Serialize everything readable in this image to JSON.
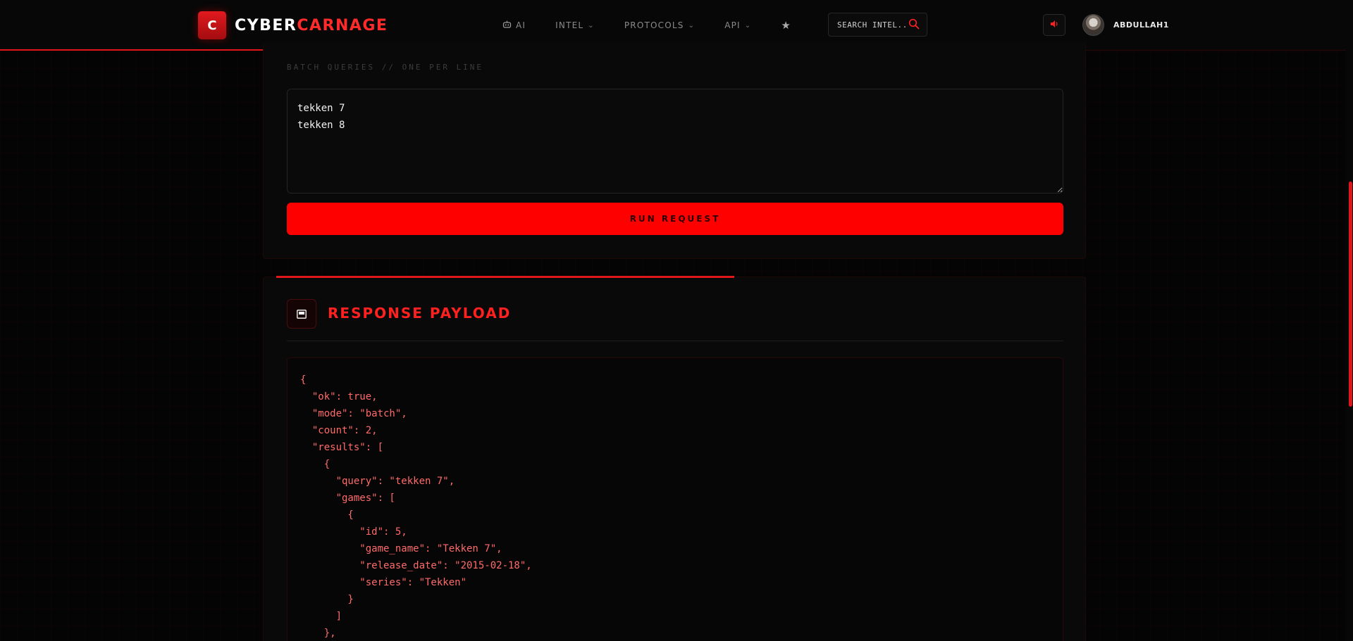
{
  "brand": {
    "logo_letter": "C",
    "name_part1": "CYBER",
    "name_part2": "CARNAGE"
  },
  "nav": {
    "items": [
      {
        "label": "AI",
        "icon": "robot-icon",
        "has_dropdown": false
      },
      {
        "label": "INTEL",
        "has_dropdown": true
      },
      {
        "label": "PROTOCOLS",
        "has_dropdown": true
      },
      {
        "label": "API",
        "has_dropdown": true
      }
    ],
    "favorites_icon": "star-icon"
  },
  "search": {
    "placeholder": "SEARCH INTEL..."
  },
  "user": {
    "name": "ABDULLAH1",
    "audio_icon": "speaker-icon"
  },
  "request": {
    "field_label": "BATCH QUERIES // ONE PER LINE",
    "textarea_value": "tekken 7\ntekken 8",
    "run_button": "RUN REQUEST"
  },
  "response": {
    "title": "RESPONSE PAYLOAD",
    "icon": "terminal-icon",
    "payload_visible": "{\n  \"ok\": true,\n  \"mode\": \"batch\",\n  \"count\": 2,\n  \"results\": [\n    {\n      \"query\": \"tekken 7\",\n      \"games\": [\n        {\n          \"id\": 5,\n          \"game_name\": \"Tekken 7\",\n          \"release_date\": \"2015-02-18\",\n          \"series\": \"Tekken\"\n        }\n      ]\n    },"
  },
  "colors": {
    "accent": "#ff0000",
    "accent_dark": "#e0161b",
    "background": "#040404",
    "code_text": "#ff6a6a"
  }
}
